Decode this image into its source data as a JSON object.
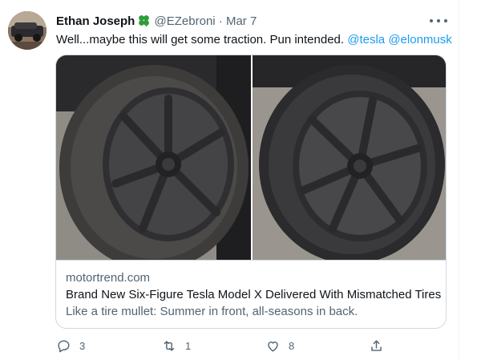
{
  "tweet": {
    "author_name": "Ethan Joseph",
    "handle": "@EZebroni",
    "separator": "·",
    "date": "Mar 7",
    "text_prefix": "Well...maybe this will get some traction. Pun intended. ",
    "mention_1": "@tesla",
    "mention_2": "@elonmusk"
  },
  "card": {
    "domain": "motortrend.com",
    "title": "Brand New Six-Figure Tesla Model X Delivered With Mismatched Tires",
    "description": "Like a tire mullet: Summer in front, all-seasons in back."
  },
  "actions": {
    "reply_count": "3",
    "retweet_count": "1",
    "like_count": "8"
  },
  "icons": {
    "badge": "four-leaf-clover-icon",
    "more": "more-options-icon",
    "reply": "reply-icon",
    "retweet": "retweet-icon",
    "like": "like-icon",
    "share": "share-icon"
  },
  "colors": {
    "link": "#1d9bf0",
    "secondary_text": "#536471",
    "clover": "#2e9e3a"
  }
}
